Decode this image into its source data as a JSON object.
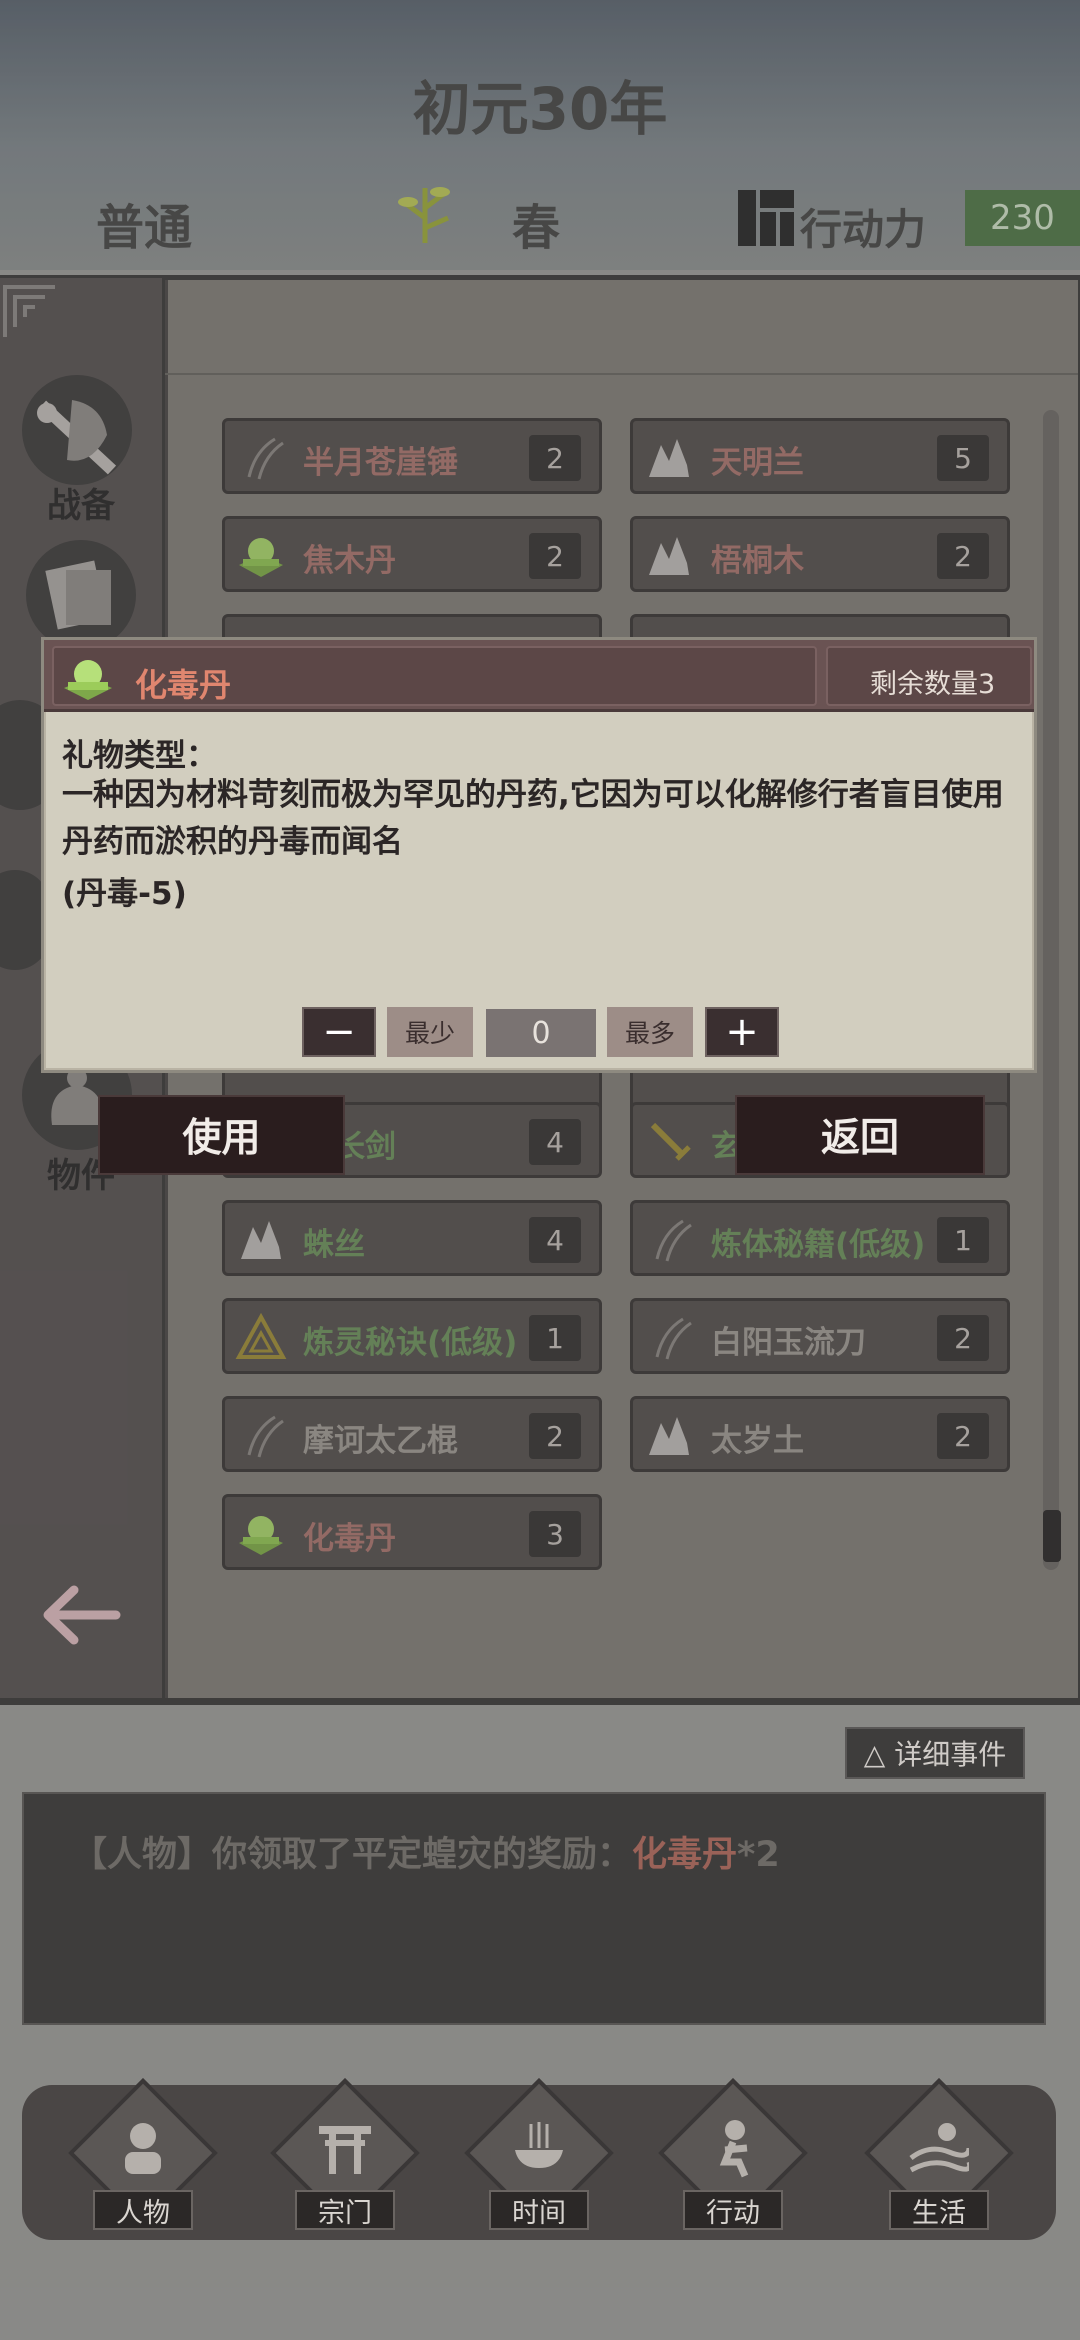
{
  "header": {
    "year": "初元30年",
    "difficulty": "普通",
    "season": "春",
    "action_points_label": "行动力",
    "action_points_value": "230"
  },
  "sidebar": {
    "label_battle": "战备",
    "label_items": "物件"
  },
  "inventory": {
    "items": [
      {
        "name": "半月苍崖锤",
        "count": "2",
        "color": "pink",
        "icon": "slash-icon"
      },
      {
        "name": "天明兰",
        "count": "5",
        "color": "pink",
        "icon": "herb-icon"
      },
      {
        "name": "焦木丹",
        "count": "2",
        "color": "pink",
        "icon": "pill-icon"
      },
      {
        "name": "梧桐木",
        "count": "2",
        "color": "pink",
        "icon": "herb-icon"
      },
      {
        "name": "秋长剑",
        "count": "4",
        "color": "green",
        "icon": "sword-icon"
      },
      {
        "name": "玄",
        "count": "",
        "color": "green",
        "icon": "sword-icon"
      },
      {
        "name": "蛛丝",
        "count": "4",
        "color": "green",
        "icon": "herb-icon"
      },
      {
        "name": "炼体秘籍(低级)",
        "count": "1",
        "color": "green",
        "icon": "slash-icon"
      },
      {
        "name": "炼灵秘诀(低级)",
        "count": "1",
        "color": "green",
        "icon": "triangle-icon"
      },
      {
        "name": "白阳玉流刀",
        "count": "2",
        "color": "gray",
        "icon": "slash-icon"
      },
      {
        "name": "摩诃太乙棍",
        "count": "2",
        "color": "gray",
        "icon": "slash-icon"
      },
      {
        "name": "太岁土",
        "count": "2",
        "color": "gray",
        "icon": "herb-icon"
      },
      {
        "name": "化毒丹",
        "count": "3",
        "color": "pink",
        "icon": "pill-icon"
      }
    ]
  },
  "popup": {
    "title": "化毒丹",
    "remaining": "剩余数量3",
    "gift_type": "礼物类型：",
    "description": "一种因为材料苛刻而极为罕见的丹药,它因为可以化解修行者盲目使用丹药而淤积的丹毒而闻名",
    "effect": "(丹毒-5)",
    "minus": "−",
    "min_label": "最少",
    "quantity": "0",
    "max_label": "最多",
    "plus": "+",
    "use_label": "使用",
    "back_label": "返回"
  },
  "events": {
    "detail_button": "△ 详细事件",
    "prefix": "【人物】你领取了平定蝗灾的奖励：",
    "highlight": "化毒丹",
    "suffix": "*2"
  },
  "nav": {
    "character": "人物",
    "sect": "宗门",
    "time": "时间",
    "action": "行动",
    "life": "生活"
  },
  "colors": {
    "pink_text": "#a7756e",
    "green_text": "#6d8f5d",
    "action_points_bg": "#52774a",
    "popup_title": "#e0866f"
  }
}
